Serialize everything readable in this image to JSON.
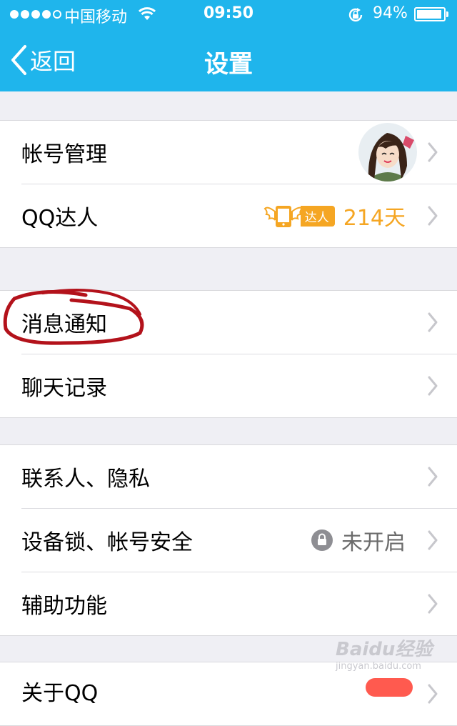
{
  "status_bar": {
    "carrier": "中国移动",
    "time": "09:50",
    "battery_percent": "94%",
    "battery_level": 0.94,
    "signal_bars": 4,
    "signal_max": 5,
    "icons": [
      "wifi-icon",
      "rotation-lock-icon",
      "battery-icon"
    ]
  },
  "nav": {
    "back_label": "返回",
    "title": "设置"
  },
  "groups": [
    {
      "rows": [
        {
          "label": "帐号管理",
          "has_avatar": true
        },
        {
          "label": "QQ达人",
          "badge_label": "达人",
          "days": "214天"
        }
      ]
    },
    {
      "rows": [
        {
          "label": "消息通知",
          "circled": true
        },
        {
          "label": "聊天记录"
        }
      ]
    },
    {
      "rows": [
        {
          "label": "联系人、隐私"
        },
        {
          "label": "设备锁、帐号安全",
          "status": "未开启"
        },
        {
          "label": "辅助功能"
        }
      ]
    },
    {
      "rows": [
        {
          "label": "关于QQ"
        }
      ]
    }
  ],
  "watermark": {
    "text": "Baidu经验",
    "sub": "jingyan.baidu.com"
  },
  "colors": {
    "header": "#1fb5ec",
    "accent_orange": "#f5a623",
    "background": "#efeff4",
    "annotation_red": "#b3121b"
  }
}
